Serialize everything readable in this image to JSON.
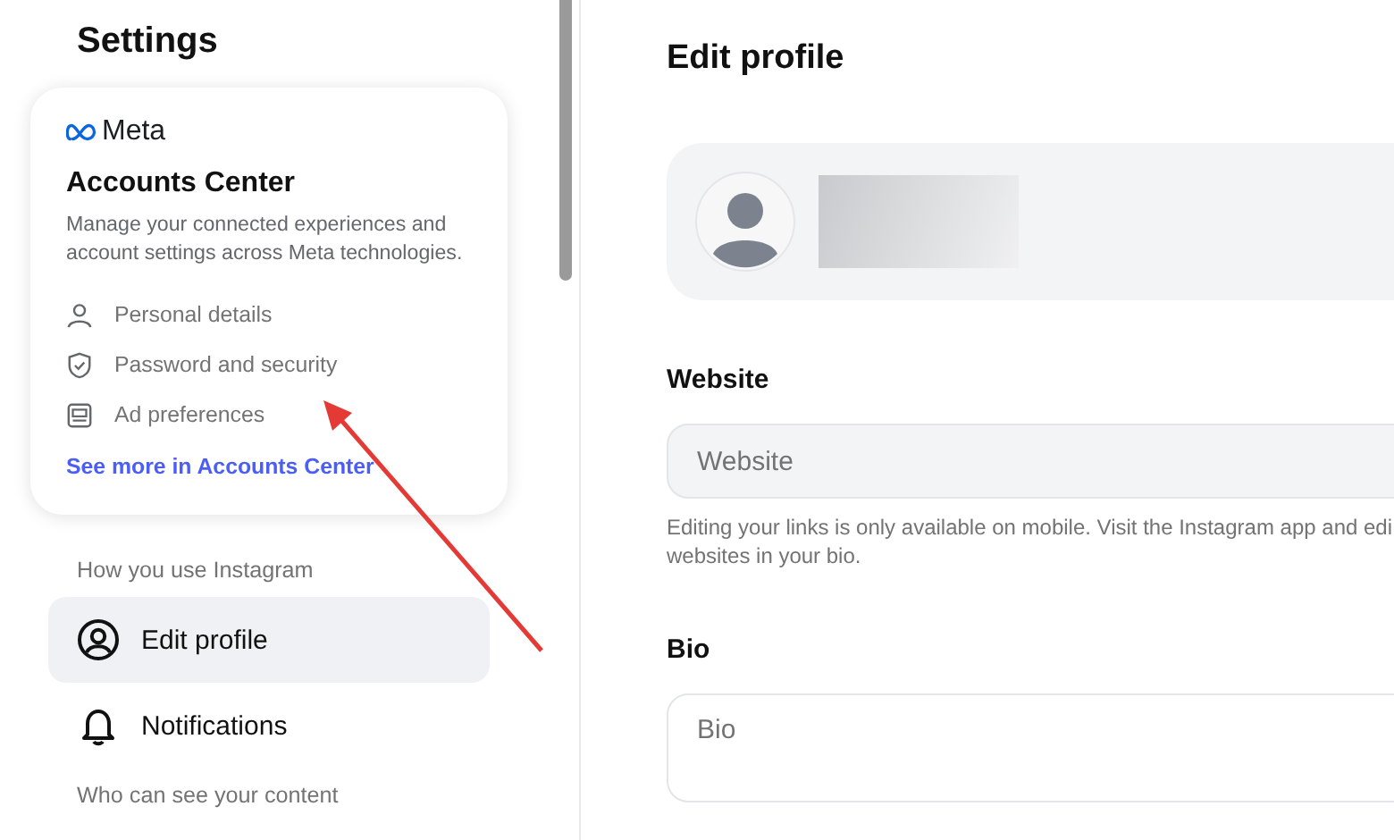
{
  "sidebar": {
    "title": "Settings",
    "accounts_center": {
      "brand": "Meta",
      "title": "Accounts Center",
      "description": "Manage your connected experiences and account settings across Meta technologies.",
      "items": [
        {
          "label": "Personal details",
          "kind": "person"
        },
        {
          "label": "Password and security",
          "kind": "shield"
        },
        {
          "label": "Ad preferences",
          "kind": "ad"
        }
      ],
      "link": "See more in Accounts Center"
    },
    "sections": [
      {
        "heading": "How you use Instagram",
        "items": [
          {
            "label": "Edit profile",
            "kind": "profile",
            "selected": true
          },
          {
            "label": "Notifications",
            "kind": "bell",
            "selected": false
          }
        ]
      },
      {
        "heading": "Who can see your content"
      }
    ]
  },
  "main": {
    "title": "Edit profile",
    "fields": [
      {
        "kind": "input",
        "label": "Website",
        "placeholder": "Website",
        "help": "Editing your links is only available on mobile. Visit the Instagram app and edi websites in your bio."
      },
      {
        "kind": "textarea",
        "label": "Bio",
        "placeholder": "Bio"
      }
    ]
  }
}
